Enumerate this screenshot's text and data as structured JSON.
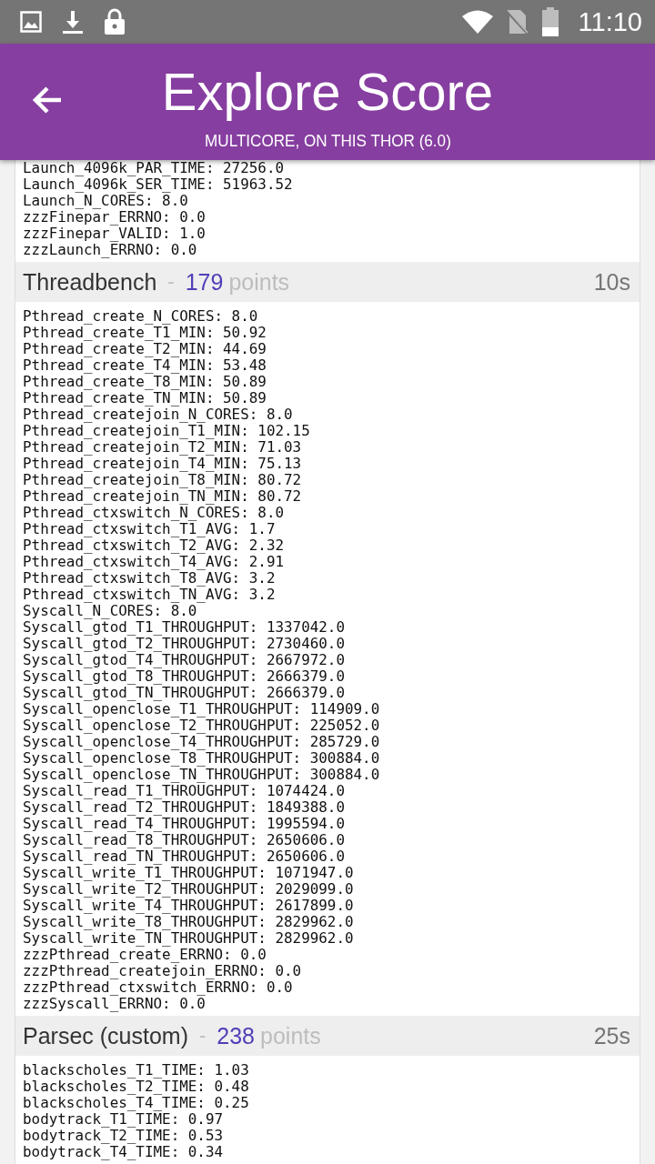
{
  "status_bar": {
    "time": "11:10"
  },
  "app_bar": {
    "title": "Explore Score",
    "subtitle": "MULTICORE, ON THIS THOR (6.0)"
  },
  "sections": [
    {
      "lines": [
        "Launch_4096k_PAR_TIME: 27256.0",
        "Launch_4096k_SER_TIME: 51963.52",
        "Launch_N_CORES: 8.0",
        "zzzFinepar_ERRNO: 0.0",
        "zzzFinepar_VALID: 1.0",
        "zzzLaunch_ERRNO: 0.0"
      ]
    },
    {
      "name": "Threadbench",
      "separator": "-",
      "points": "179",
      "points_label": "points",
      "duration": "10s",
      "lines": [
        "Pthread_create_N_CORES: 8.0",
        "Pthread_create_T1_MIN: 50.92",
        "Pthread_create_T2_MIN: 44.69",
        "Pthread_create_T4_MIN: 53.48",
        "Pthread_create_T8_MIN: 50.89",
        "Pthread_create_TN_MIN: 50.89",
        "Pthread_createjoin_N_CORES: 8.0",
        "Pthread_createjoin_T1_MIN: 102.15",
        "Pthread_createjoin_T2_MIN: 71.03",
        "Pthread_createjoin_T4_MIN: 75.13",
        "Pthread_createjoin_T8_MIN: 80.72",
        "Pthread_createjoin_TN_MIN: 80.72",
        "Pthread_ctxswitch_N_CORES: 8.0",
        "Pthread_ctxswitch_T1_AVG: 1.7",
        "Pthread_ctxswitch_T2_AVG: 2.32",
        "Pthread_ctxswitch_T4_AVG: 2.91",
        "Pthread_ctxswitch_T8_AVG: 3.2",
        "Pthread_ctxswitch_TN_AVG: 3.2",
        "Syscall_N_CORES: 8.0",
        "Syscall_gtod_T1_THROUGHPUT: 1337042.0",
        "Syscall_gtod_T2_THROUGHPUT: 2730460.0",
        "Syscall_gtod_T4_THROUGHPUT: 2667972.0",
        "Syscall_gtod_T8_THROUGHPUT: 2666379.0",
        "Syscall_gtod_TN_THROUGHPUT: 2666379.0",
        "Syscall_openclose_T1_THROUGHPUT: 114909.0",
        "Syscall_openclose_T2_THROUGHPUT: 225052.0",
        "Syscall_openclose_T4_THROUGHPUT: 285729.0",
        "Syscall_openclose_T8_THROUGHPUT: 300884.0",
        "Syscall_openclose_TN_THROUGHPUT: 300884.0",
        "Syscall_read_T1_THROUGHPUT: 1074424.0",
        "Syscall_read_T2_THROUGHPUT: 1849388.0",
        "Syscall_read_T4_THROUGHPUT: 1995594.0",
        "Syscall_read_T8_THROUGHPUT: 2650606.0",
        "Syscall_read_TN_THROUGHPUT: 2650606.0",
        "Syscall_write_T1_THROUGHPUT: 1071947.0",
        "Syscall_write_T2_THROUGHPUT: 2029099.0",
        "Syscall_write_T4_THROUGHPUT: 2617899.0",
        "Syscall_write_T8_THROUGHPUT: 2829962.0",
        "Syscall_write_TN_THROUGHPUT: 2829962.0",
        "zzzPthread_create_ERRNO: 0.0",
        "zzzPthread_createjoin_ERRNO: 0.0",
        "zzzPthread_ctxswitch_ERRNO: 0.0",
        "zzzSyscall_ERRNO: 0.0"
      ]
    },
    {
      "name": "Parsec (custom)",
      "separator": "-",
      "points": "238",
      "points_label": "points",
      "duration": "25s",
      "lines": [
        "blackscholes_T1_TIME: 1.03",
        "blackscholes_T2_TIME: 0.48",
        "blackscholes_T4_TIME: 0.25",
        "bodytrack_T1_TIME: 0.97",
        "bodytrack_T2_TIME: 0.53",
        "bodytrack_T4_TIME: 0.34"
      ]
    }
  ]
}
